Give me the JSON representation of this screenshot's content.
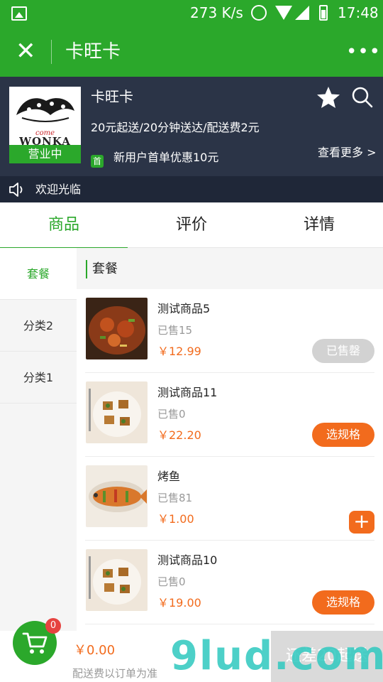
{
  "status_bar": {
    "speed": "273 K/s",
    "time": "17:48"
  },
  "titlebar": {
    "close": "✕",
    "title": "卡旺卡",
    "more": "•••"
  },
  "shop": {
    "logo_small_text": "come",
    "logo_brand": "WONKA",
    "status": "营业中",
    "name": "卡旺卡",
    "info": "20元起送/20分钟送达/配送费2元",
    "promo_badge": "首",
    "promo": "新用户首单优惠10元",
    "see_more": "查看更多 >",
    "icons": [
      "star-icon",
      "search-icon"
    ]
  },
  "notice": {
    "icon": "speaker-icon",
    "text": "欢迎光临"
  },
  "tabs": [
    {
      "label": "商品",
      "active": true
    },
    {
      "label": "评价",
      "active": false
    },
    {
      "label": "详情",
      "active": false
    }
  ],
  "categories": [
    {
      "label": "套餐",
      "active": true
    },
    {
      "label": "分类2",
      "active": false
    },
    {
      "label": "分类1",
      "active": false
    }
  ],
  "section": {
    "title": "套餐"
  },
  "products": [
    {
      "name": "测试商品5",
      "sold": "已售15",
      "price": "￥12.99",
      "action": "已售罄",
      "action_type": "soldout"
    },
    {
      "name": "测试商品11",
      "sold": "已售0",
      "price": "￥22.20",
      "action": "选规格",
      "action_type": "spec"
    },
    {
      "name": "烤鱼",
      "sold": "已售81",
      "price": "￥1.00",
      "action": "+",
      "action_type": "add"
    },
    {
      "name": "测试商品10",
      "sold": "已售0",
      "price": "￥19.00",
      "action": "选规格",
      "action_type": "spec"
    }
  ],
  "cart": {
    "count": "0",
    "total": "￥0.00",
    "delivery_note": "配送费以订单为准",
    "checkout": "还差20起送"
  },
  "watermark": "9lud.com",
  "colors": {
    "primary_green": "#2ba82b",
    "header_dark": "#2b3447",
    "accent_orange": "#f26b1d",
    "disabled_gray": "#d2d2d2"
  }
}
